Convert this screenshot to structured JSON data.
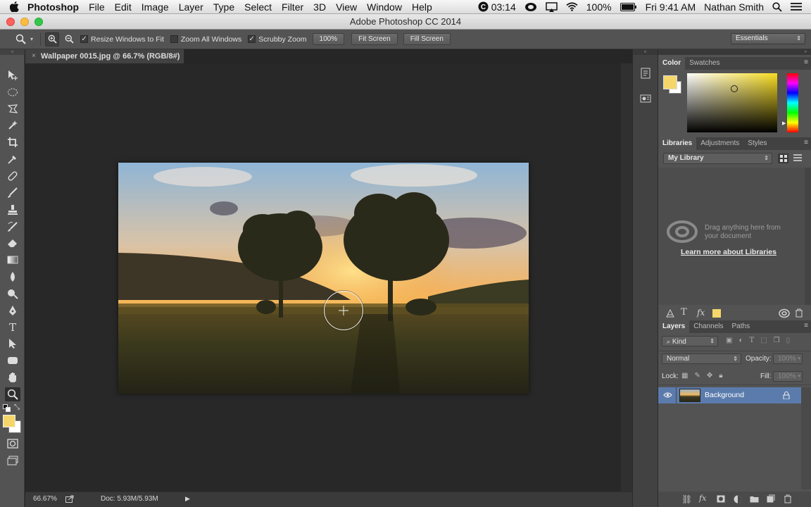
{
  "menubar": {
    "app_name": "Photoshop",
    "items": [
      "File",
      "Edit",
      "Image",
      "Layer",
      "Type",
      "Select",
      "Filter",
      "3D",
      "View",
      "Window",
      "Help"
    ],
    "clock_icon_text": "03:14",
    "battery": "100%",
    "datetime": "Fri 9:41 AM",
    "user": "Nathan Smith"
  },
  "window": {
    "title": "Adobe Photoshop CC 2014"
  },
  "options_bar": {
    "resize_windows_label": "Resize Windows to Fit",
    "zoom_all_label": "Zoom All Windows",
    "scrubby_zoom_label": "Scrubby Zoom",
    "zoom_100_label": "100%",
    "fit_screen_label": "Fit Screen",
    "fill_screen_label": "Fill Screen",
    "workspace": "Essentials"
  },
  "document": {
    "tab_title": "Wallpaper 0015.jpg @ 66.7% (RGB/8#)",
    "zoom": "66.67%",
    "doc_size": "Doc: 5.93M/5.93M"
  },
  "color_panel": {
    "tabs": [
      "Color",
      "Swatches"
    ],
    "foreground": "#f5d66b",
    "background": "#ffffff"
  },
  "libraries_panel": {
    "tabs": [
      "Libraries",
      "Adjustments",
      "Styles"
    ],
    "library": "My Library",
    "hint": "Drag anything here from your document",
    "learn_more": "Learn more about Libraries"
  },
  "layers_panel": {
    "tabs": [
      "Layers",
      "Channels",
      "Paths"
    ],
    "filter_kind": "Kind",
    "blend_mode": "Normal",
    "opacity_label": "Opacity:",
    "opacity_value": "100%",
    "lock_label": "Lock:",
    "fill_label": "Fill:",
    "fill_value": "100%",
    "layers": [
      {
        "name": "Background",
        "selected": true
      }
    ]
  }
}
